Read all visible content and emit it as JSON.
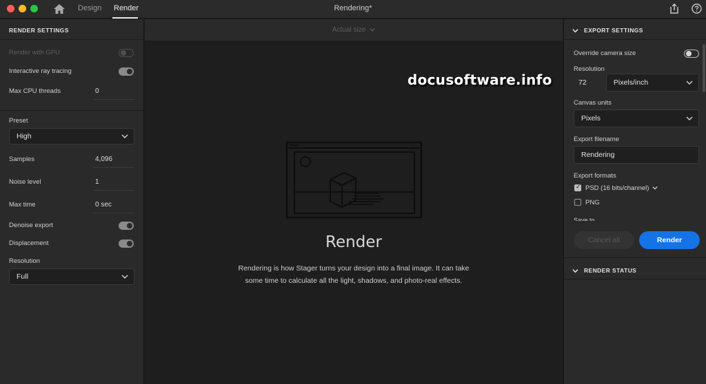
{
  "window": {
    "title": "Rendering*",
    "tabs": [
      {
        "label": "Design",
        "active": false
      },
      {
        "label": "Render",
        "active": true
      }
    ]
  },
  "left_panel": {
    "header": "RENDER SETTINGS",
    "render_with_gpu": {
      "label": "Render with GPU",
      "enabled": false,
      "on": false
    },
    "interactive_ray_tracing": {
      "label": "Interactive ray tracing",
      "on": true
    },
    "max_cpu_threads": {
      "label": "Max CPU threads",
      "value": "0"
    },
    "preset": {
      "label": "Preset",
      "value": "High"
    },
    "samples": {
      "label": "Samples",
      "value": "4,096"
    },
    "noise_level": {
      "label": "Noise level",
      "value": "1"
    },
    "max_time": {
      "label": "Max time",
      "value": "0 sec"
    },
    "denoise_export": {
      "label": "Denoise export",
      "on": true
    },
    "displacement": {
      "label": "Displacement",
      "on": true
    },
    "resolution": {
      "label": "Resolution",
      "value": "Full"
    }
  },
  "center": {
    "zoom_label": "Actual size",
    "watermark": "docusoftware.info",
    "heading": "Render",
    "description_line1": "Rendering is how Stager turns your design into a final image. It can take",
    "description_line2": "some time to calculate all the light, shadows, and photo-real effects."
  },
  "right_panel": {
    "export_header": "EXPORT SETTINGS",
    "override_camera_size": {
      "label": "Override camera size",
      "on": false
    },
    "resolution": {
      "label": "Resolution",
      "value": "72",
      "unit": "Pixels/inch"
    },
    "canvas_units": {
      "label": "Canvas units",
      "value": "Pixels"
    },
    "export_filename": {
      "label": "Export filename",
      "value": "Rendering"
    },
    "export_formats": {
      "label": "Export formats",
      "psd": {
        "label": "PSD (16 bits/channel)",
        "checked": true
      },
      "png": {
        "label": "PNG",
        "checked": false
      }
    },
    "save_to_label": "Save to",
    "cancel_label": "Cancel all",
    "render_label": "Render",
    "status_header": "RENDER STATUS"
  },
  "colors": {
    "accent": "#1473e6",
    "panel_bg": "#2a2a2a",
    "canvas_bg": "#1e1e1e"
  },
  "icons": [
    "home-icon",
    "share-icon",
    "help-icon",
    "chevron-down-icon",
    "render-illustration"
  ]
}
